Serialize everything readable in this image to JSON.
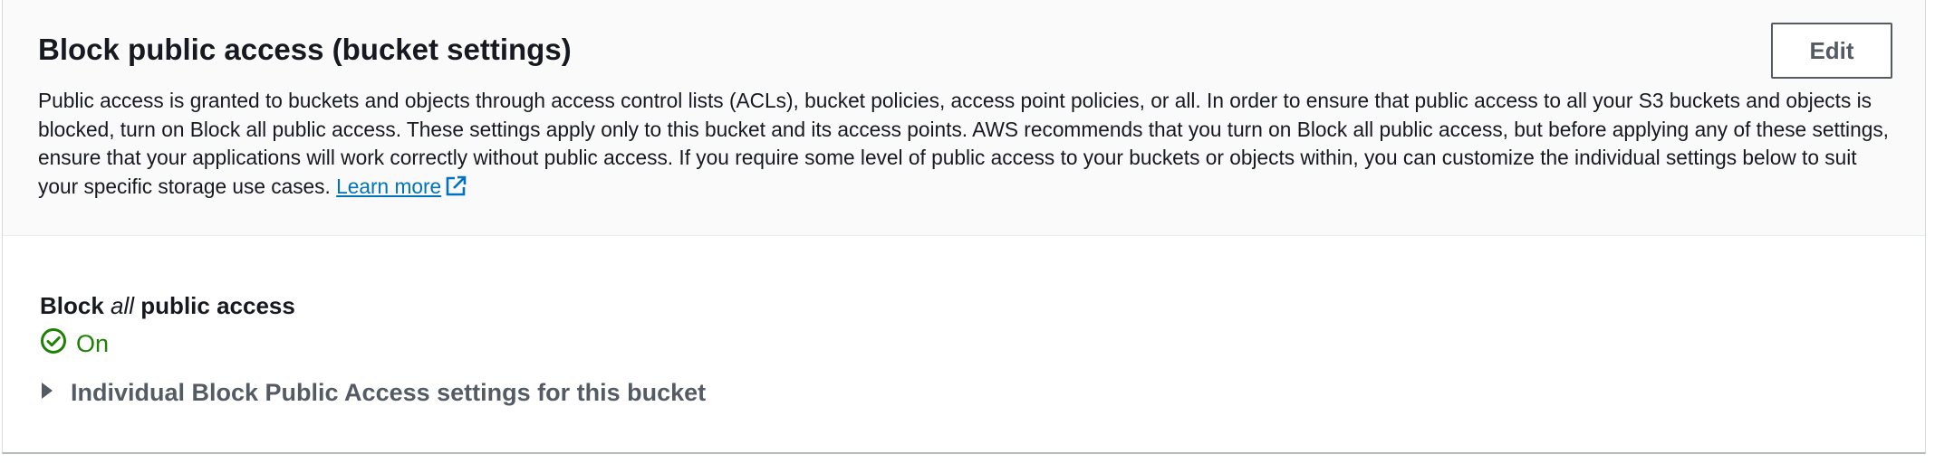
{
  "header": {
    "title": "Block public access (bucket settings)",
    "edit_label": "Edit",
    "description": "Public access is granted to buckets and objects through access control lists (ACLs), bucket policies, access point policies, or all. In order to ensure that public access to all your S3 buckets and objects is blocked, turn on Block all public access. These settings apply only to this bucket and its access points. AWS recommends that you turn on Block all public access, but before applying any of these settings, ensure that your applications will work correctly without public access. If you require some level of public access to your buckets or objects within, you can customize the individual settings below to suit your specific storage use cases.",
    "learn_more_label": "Learn more",
    "learn_more_icon": "external-link-icon"
  },
  "block_all": {
    "label_prefix": "Block",
    "label_emphasis": "all",
    "label_suffix": "public access",
    "status_text": "On",
    "status_icon": "check-circle-icon",
    "status_color": "#1d8102"
  },
  "individual_settings": {
    "label": "Individual Block Public Access settings for this bucket",
    "icon": "caret-right-icon",
    "expanded": false
  },
  "colors": {
    "link": "#0073bb",
    "text": "#16191f",
    "secondary_text": "#545b64",
    "header_background": "#fafafa"
  }
}
